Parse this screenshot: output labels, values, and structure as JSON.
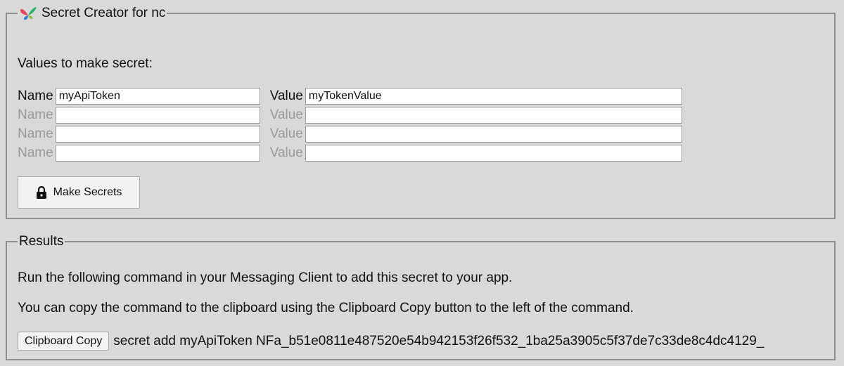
{
  "creator": {
    "legend": "Secret Creator for nc",
    "intro": "Values to make secret:",
    "rows": [
      {
        "name_label": "Name",
        "name_value": "myApiToken",
        "value_label": "Value",
        "value_value": "myTokenValue"
      },
      {
        "name_label": "Name",
        "name_value": "",
        "value_label": "Value",
        "value_value": ""
      },
      {
        "name_label": "Name",
        "name_value": "",
        "value_label": "Value",
        "value_value": ""
      },
      {
        "name_label": "Name",
        "name_value": "",
        "value_label": "Value",
        "value_value": ""
      }
    ],
    "make_button": "Make Secrets",
    "make_button_icon": "lock-icon"
  },
  "results": {
    "legend": "Results",
    "instruction": "Run the following command in your Messaging Client to add this secret to your app.",
    "copy_hint": "You can copy the command to the clipboard using the Clipboard Copy button to the left of the command.",
    "copy_button": "Clipboard Copy",
    "command": "secret add myApiToken NFa_b51e0811e487520e54b942153f26f532_1ba25a3905c5f37de7c33de8c4dc4129_"
  }
}
